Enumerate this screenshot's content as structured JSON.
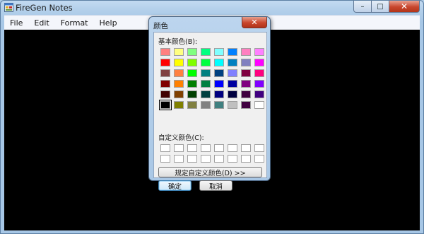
{
  "app": {
    "title": "FireGen Notes",
    "icon": "app-window-icon"
  },
  "window_controls": {
    "minimize": "–",
    "maximize": "□",
    "close": "✕"
  },
  "menu": [
    {
      "label": "File"
    },
    {
      "label": "Edit"
    },
    {
      "label": "Format"
    },
    {
      "label": "Help"
    }
  ],
  "dialog": {
    "title": "颜色",
    "close_label": "✕",
    "basic_colors_label": "基本颜色(B):",
    "basic_colors": [
      "#ff8080",
      "#ffff80",
      "#80ff80",
      "#00ff80",
      "#80ffff",
      "#0080ff",
      "#ff80c0",
      "#ff80ff",
      "#ff0000",
      "#ffff00",
      "#80ff00",
      "#00ff40",
      "#00ffff",
      "#0080c0",
      "#8080c0",
      "#ff00ff",
      "#804040",
      "#ff8040",
      "#00ff00",
      "#008080",
      "#004080",
      "#8080ff",
      "#800040",
      "#ff0080",
      "#800000",
      "#ff8000",
      "#008000",
      "#008040",
      "#0000ff",
      "#0000a0",
      "#800080",
      "#8000ff",
      "#400000",
      "#804000",
      "#004000",
      "#004040",
      "#000080",
      "#000040",
      "#400040",
      "#400080",
      "#000000",
      "#808000",
      "#808040",
      "#808080",
      "#408080",
      "#c0c0c0",
      "#400040",
      "#ffffff"
    ],
    "selected_index": 40,
    "custom_colors_label": "自定义颜色(C):",
    "custom_colors": [
      "#ffffff",
      "#ffffff",
      "#ffffff",
      "#ffffff",
      "#ffffff",
      "#ffffff",
      "#ffffff",
      "#ffffff",
      "#ffffff",
      "#ffffff",
      "#ffffff",
      "#ffffff",
      "#ffffff",
      "#ffffff",
      "#ffffff",
      "#ffffff"
    ],
    "define_button": "规定自定义颜色(D) >>",
    "ok_button": "确定",
    "cancel_button": "取消"
  }
}
